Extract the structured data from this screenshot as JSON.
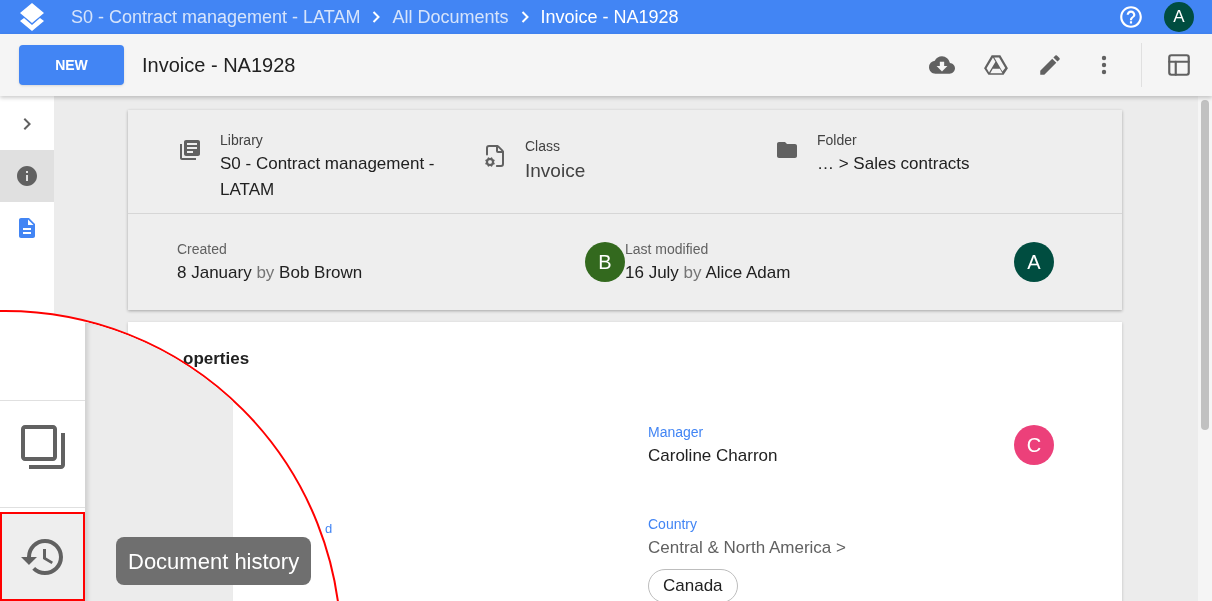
{
  "topbar": {
    "breadcrumbs": [
      {
        "label": "S0 - Contract management - LATAM",
        "current": false
      },
      {
        "label": "All Documents",
        "current": false
      },
      {
        "label": "Invoice - NA1928",
        "current": true
      }
    ],
    "user_avatar": {
      "letter": "A",
      "color": "#004d40"
    }
  },
  "toolbar": {
    "new_button": "NEW",
    "title": "Invoice - NA1928",
    "actions": [
      {
        "kind": "download"
      },
      {
        "kind": "drive"
      },
      {
        "kind": "edit"
      },
      {
        "kind": "more"
      },
      {
        "kind": "layout"
      }
    ]
  },
  "rail": {
    "items": [
      {
        "kind": "expand",
        "selected": false
      },
      {
        "kind": "info",
        "selected": true
      },
      {
        "kind": "document",
        "selected": false
      }
    ]
  },
  "info_card": {
    "fields": [
      {
        "kind": "library",
        "label": "Library",
        "value": "S0 - Contract management - LATAM"
      },
      {
        "kind": "class",
        "label": "Class",
        "value": "Invoice"
      },
      {
        "kind": "folder",
        "label": "Folder",
        "value": "… > Sales contracts"
      }
    ],
    "history": [
      {
        "label": "Created",
        "date": "8 January",
        "by": "by",
        "name": "Bob Brown",
        "avatar": "B",
        "color": "#33691e"
      },
      {
        "label": "Last modified",
        "date": "16 July",
        "by": "by",
        "name": "Alice Adam",
        "avatar": "A",
        "color": "#004d40"
      }
    ]
  },
  "properties": {
    "title": "operties",
    "field_label": "d",
    "manager": {
      "label": "Manager",
      "name": "Caroline Charron",
      "avatar": "C",
      "color": "#ec407a"
    },
    "country": {
      "label": "Country",
      "path": "Central & North America >",
      "chip": "Canada"
    }
  },
  "magnifier": {
    "items": [
      {
        "kind": "copy",
        "highlighted": false
      },
      {
        "kind": "history",
        "highlighted": true
      }
    ],
    "tooltip": "Document history"
  }
}
